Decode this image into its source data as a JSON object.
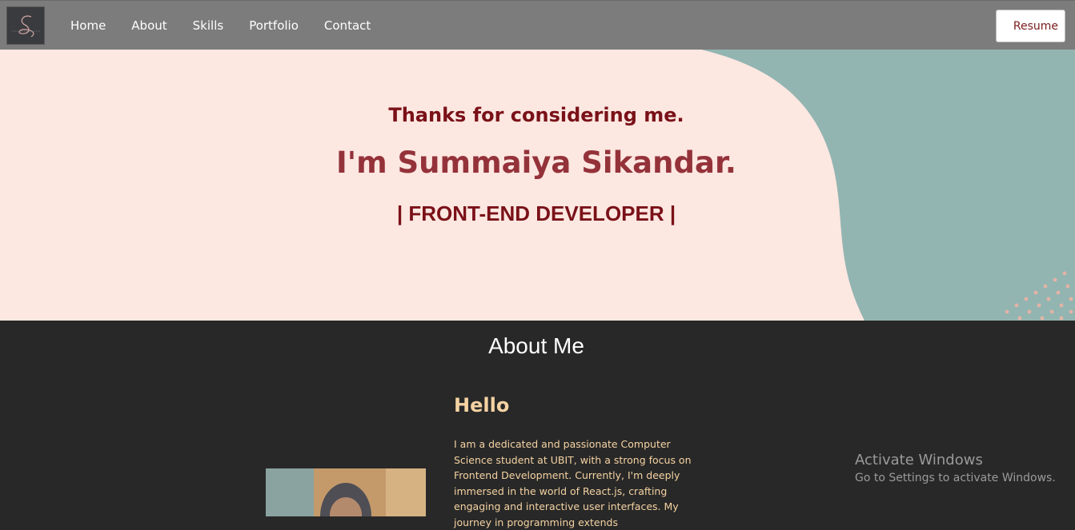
{
  "nav": {
    "logo_icon": "signature-logo-icon",
    "links": [
      "Home",
      "About",
      "Skills",
      "Portfolio",
      "Contact"
    ],
    "resume_label": "Resume"
  },
  "hero": {
    "greeting": "Thanks for considering me.",
    "name": "I'm Summaiya Sikandar.",
    "role": "| FRONT-END DEVELOPER |"
  },
  "about": {
    "title": "About Me",
    "hello": "Hello",
    "body": "I am a dedicated and passionate Computer Science student at UBIT, with a strong focus on Frontend Development. Currently, I'm deeply immersed in the world of React.js, crafting engaging and interactive user interfaces. My journey in programming extends"
  },
  "watermark": {
    "title": "Activate Windows",
    "subtitle": "Go to Settings to activate Windows."
  },
  "colors": {
    "navbar": "#7c7c7c",
    "hero_bg": "#fde7e1",
    "hero_blob": "#93b5b1",
    "accent_dark_red": "#7a1118",
    "about_bg": "#282828",
    "about_text": "#f5d3a3"
  }
}
